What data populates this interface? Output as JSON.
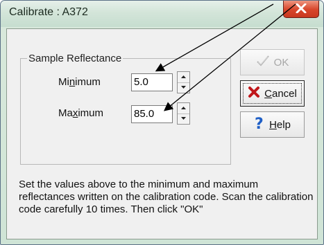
{
  "window": {
    "title": "Calibrate : A372"
  },
  "group": {
    "title": "Sample Reflectance"
  },
  "fields": {
    "minimum": {
      "label_pre": "Mi",
      "label_accel": "n",
      "label_post": "imum",
      "value": "5.0"
    },
    "maximum": {
      "label_pre": "Ma",
      "label_accel": "x",
      "label_post": "imum",
      "value": "85.0"
    }
  },
  "buttons": {
    "ok": {
      "label": "OK",
      "icon": "checkmark-icon",
      "enabled": false
    },
    "cancel": {
      "label_accel": "C",
      "label_rest": "ancel",
      "icon": "red-x-icon"
    },
    "help": {
      "label_accel": "H",
      "label_rest": "elp",
      "icon": "blue-question-icon"
    }
  },
  "instructions": "Set the values above to the minimum and maximum reflectances written on the calibration code. Scan the calibration code carefully 10 times. Then click \"OK\"",
  "colors": {
    "titlebar": "#d3e5d9",
    "close": "#d8462b",
    "client_bg": "#f0f0f0",
    "cancel_icon": "#c0171b",
    "help_icon": "#1f5fc6"
  }
}
